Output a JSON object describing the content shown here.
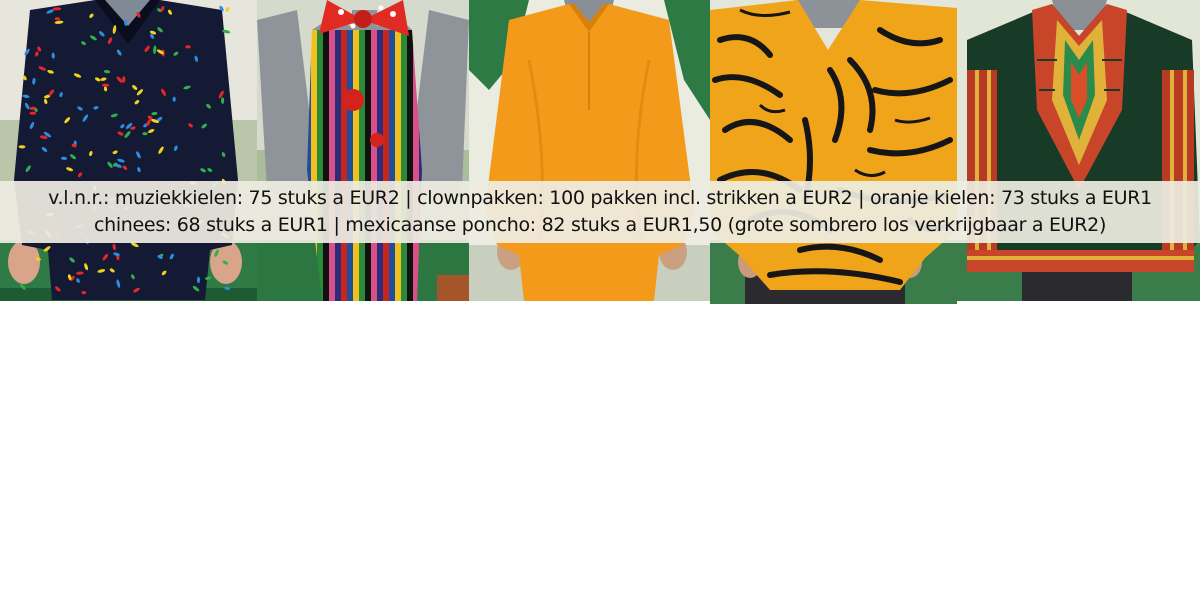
{
  "caption": {
    "line1": "v.l.n.r.: muziekkielen: 75 stuks a EUR2 | clownpakken: 100 pakken incl. strikken a EUR2 | oranje kielen: 73 stuks a EUR1",
    "line2": "chinees: 68 stuks a EUR1 | mexicaanse poncho: 82 stuks a EUR1,50 (grote sombrero los verkrijgbaar a EUR2)"
  },
  "photos": [
    {
      "subject": "muziekkiel",
      "colors": [
        "#10142a",
        "#e8252a",
        "#f3d21b",
        "#2e8de0",
        "#2fb04a"
      ]
    },
    {
      "subject": "clownpak",
      "colors": [
        "#c8261c",
        "#1f4f9c",
        "#f2c01c",
        "#2a8a3a",
        "#d94f8a"
      ]
    },
    {
      "subject": "oranje kiel",
      "colors": [
        "#f39a1b",
        "#e6850d"
      ]
    },
    {
      "subject": "chinees",
      "colors": [
        "#f0a41a",
        "#161616"
      ]
    },
    {
      "subject": "mexicaanse poncho",
      "colors": [
        "#173b26",
        "#c9452a",
        "#e0b23a"
      ]
    }
  ]
}
